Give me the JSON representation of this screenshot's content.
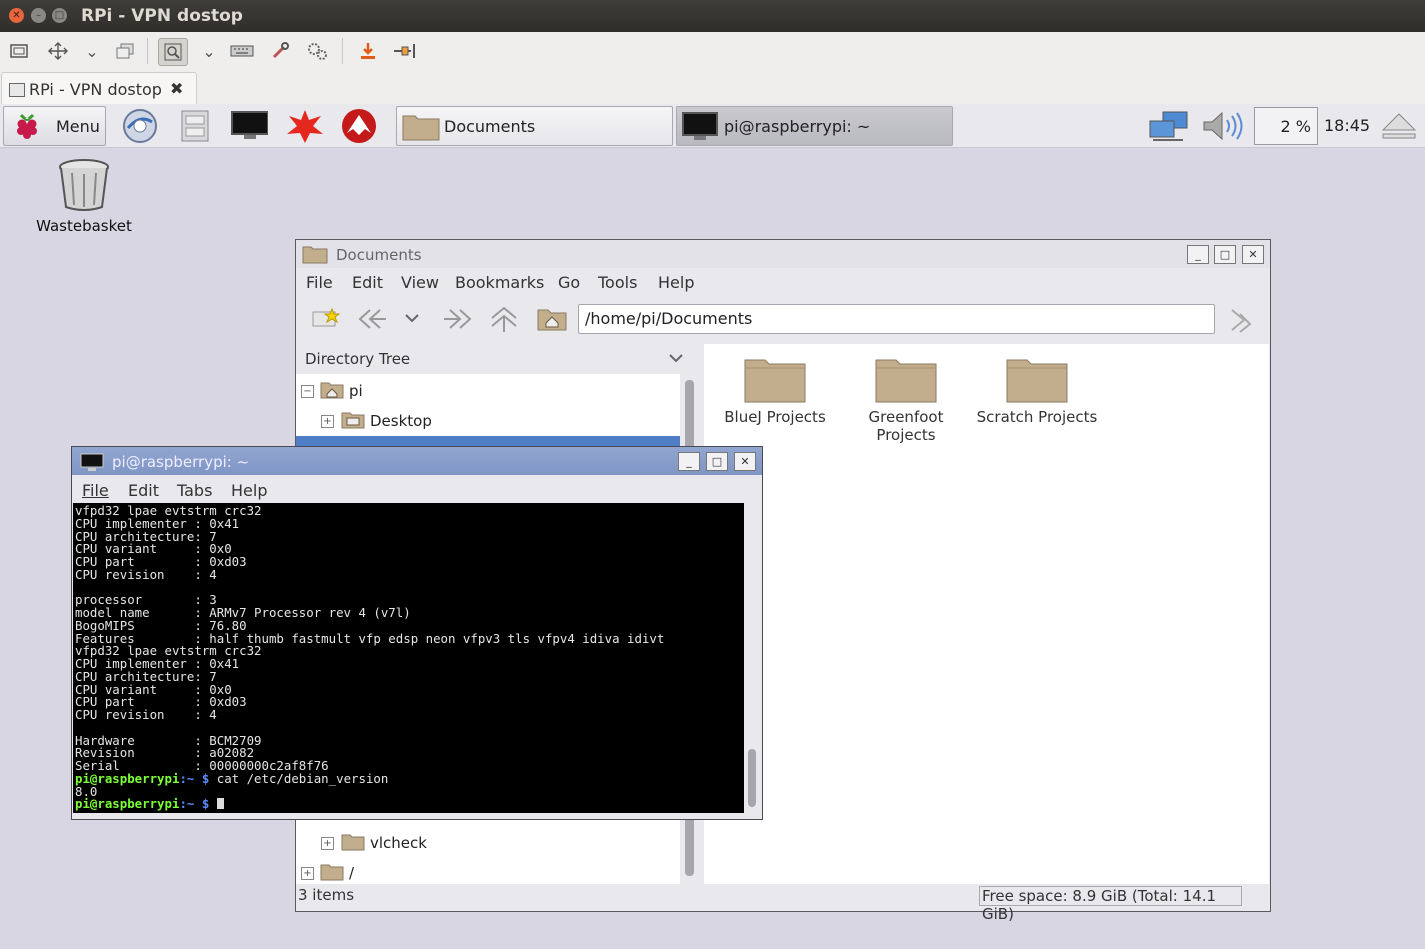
{
  "outer": {
    "window_title": "RPi - VPN dostop",
    "tab_label": "RPi - VPN dostop"
  },
  "panel": {
    "menu_label": "Menu",
    "tasks": [
      {
        "label": "Documents"
      },
      {
        "label": "pi@raspberrypi: ~"
      }
    ],
    "cpu_usage": "2 %",
    "clock": "18:45"
  },
  "desktop": {
    "wastebasket_label": "Wastebasket"
  },
  "file_manager": {
    "title": "Documents",
    "menu": [
      "File",
      "Edit",
      "View",
      "Bookmarks",
      "Go",
      "Tools",
      "Help"
    ],
    "path": "/home/pi/Documents",
    "tree_header": "Directory Tree",
    "tree": [
      {
        "label": "pi"
      },
      {
        "label": "Desktop"
      },
      {
        "label": "vlcheck"
      },
      {
        "label": "/"
      }
    ],
    "files": [
      {
        "label": "BlueJ Projects"
      },
      {
        "label": "Greenfoot Projects"
      },
      {
        "label": "Scratch Projects"
      }
    ],
    "status_left": "3 items",
    "status_right": "Free space: 8.9 GiB (Total: 14.1 GiB)"
  },
  "terminal": {
    "title": "pi@raspberrypi: ~",
    "menu": [
      "File",
      "Edit",
      "Tabs",
      "Help"
    ],
    "output": "vfpd32 lpae evtstrm crc32\nCPU implementer : 0x41\nCPU architecture: 7\nCPU variant     : 0x0\nCPU part        : 0xd03\nCPU revision    : 4\n\nprocessor       : 3\nmodel name      : ARMv7 Processor rev 4 (v7l)\nBogoMIPS        : 76.80\nFeatures        : half thumb fastmult vfp edsp neon vfpv3 tls vfpv4 idiva idivt\nvfpd32 lpae evtstrm crc32\nCPU implementer : 0x41\nCPU architecture: 7\nCPU variant     : 0x0\nCPU part        : 0xd03\nCPU revision    : 4\n\nHardware        : BCM2709\nRevision        : a02082\nSerial          : 00000000c2af8f76",
    "prompt_user": "pi@raspberrypi",
    "prompt_path": ":~ $",
    "command": "cat /etc/debian_version",
    "command_output": "8.0"
  }
}
